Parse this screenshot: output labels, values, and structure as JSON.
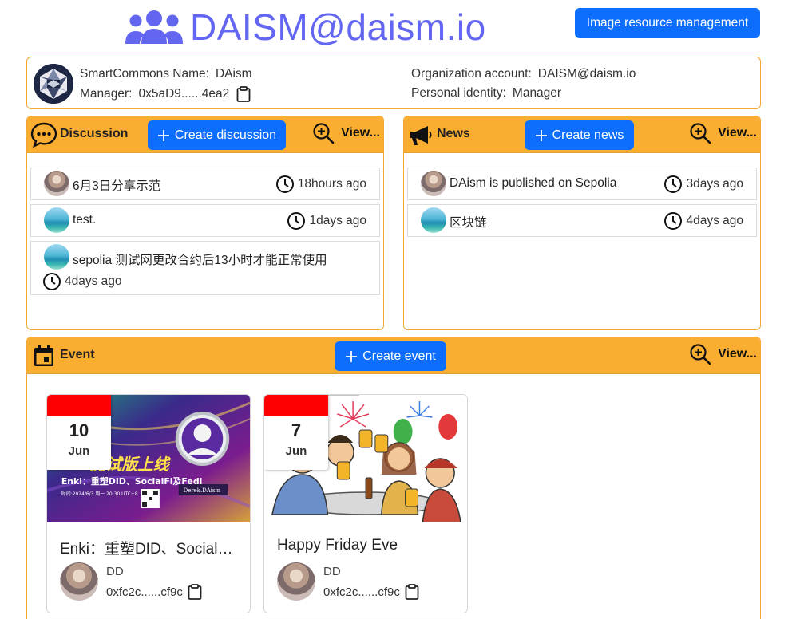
{
  "header": {
    "brand": "DAISM@daism.io",
    "image_mgmt_label": "Image resource management"
  },
  "info": {
    "name_label": "SmartCommons Name:",
    "name_value": "DAism",
    "manager_label": "Manager:",
    "manager_value": "0x5aD9......4ea2",
    "org_label": "Organization account:",
    "org_value": "DAISM@daism.io",
    "identity_label": "Personal identity:",
    "identity_value": "Manager"
  },
  "discussion": {
    "title": "Discussion",
    "create_label": "Create discussion",
    "view_label": "View...",
    "items": [
      {
        "text": "6月3日分享示范",
        "time": "18hours ago"
      },
      {
        "text": "test.",
        "time": "1days ago"
      },
      {
        "text": "sepolia 测试网更改合约后13小时才能正常使用",
        "time": "4days ago"
      }
    ]
  },
  "news": {
    "title": "News",
    "create_label": "Create news",
    "view_label": "View...",
    "items": [
      {
        "text": "DAism is published on Sepolia",
        "time": "3days ago"
      },
      {
        "text": "区块链",
        "time": "4days ago"
      }
    ]
  },
  "event": {
    "title": "Event",
    "create_label": "Create event",
    "view_label": "View...",
    "cards": [
      {
        "day": "10",
        "month": "Jun",
        "title": "Enki：重塑DID、SocialFi及Fedi...",
        "banner_text": "测试版上线",
        "banner_sub": "Enki：重塑DID、SocialFi及Fedi",
        "banner_time": "时间:2024/6/3 周一 20:30 UTC+8",
        "banner_name": "Derek.DAism",
        "user": "DD",
        "address": "0xfc2c......cf9c"
      },
      {
        "day": "7",
        "month": "Jun",
        "title": "Happy Friday Eve",
        "user": "DD",
        "address": "0xfc2c......cf9c"
      }
    ]
  },
  "colors": {
    "accent": "#6366f1",
    "primary": "#0d6efd",
    "panel_header": "#f9ad31",
    "panel_border": "#f4a834",
    "date_red": "#ff0000"
  }
}
